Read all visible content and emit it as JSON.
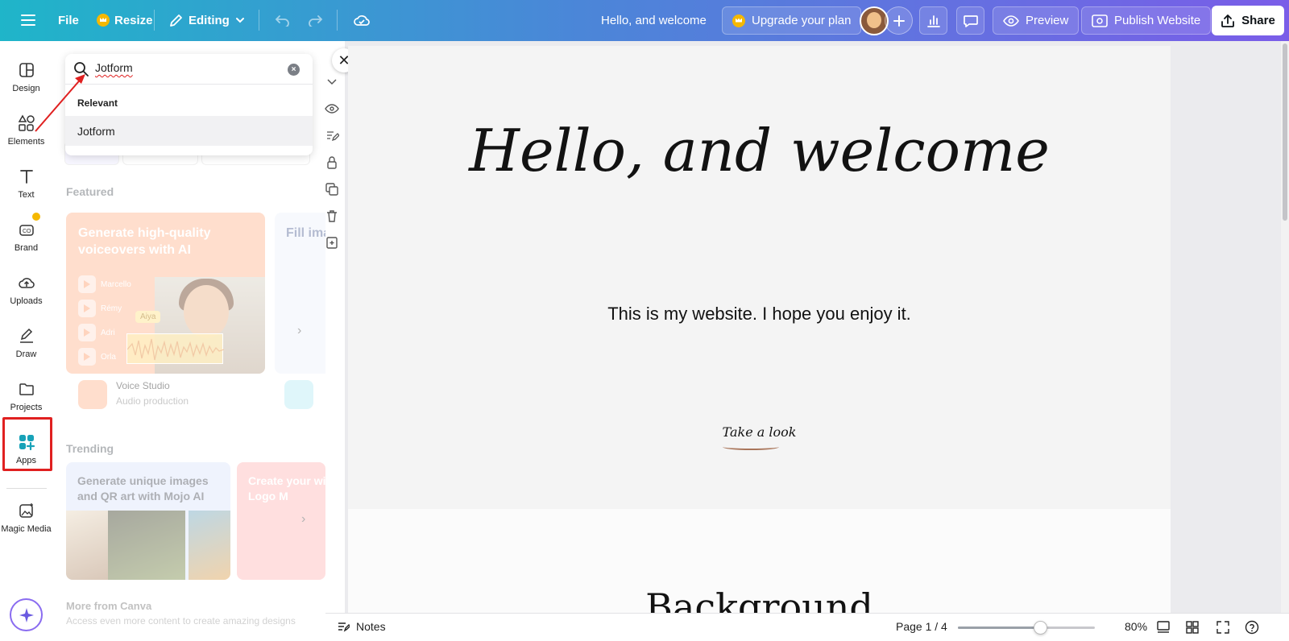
{
  "topbar": {
    "file": "File",
    "resize": "Resize",
    "editing": "Editing",
    "doc_title": "Hello, and welcome",
    "upgrade": "Upgrade your plan",
    "preview": "Preview",
    "publish": "Publish Website",
    "share": "Share"
  },
  "rail": {
    "design": "Design",
    "elements": "Elements",
    "text": "Text",
    "brand": "Brand",
    "uploads": "Uploads",
    "draw": "Draw",
    "projects": "Projects",
    "apps": "Apps",
    "magic_media": "Magic Media"
  },
  "search": {
    "value": "Jotform",
    "relevant_label": "Relevant",
    "result": "Jotform"
  },
  "panel": {
    "featured_title": "Featured",
    "feature1_title": "Generate high-quality voiceovers with AI",
    "feature2_title": "Fill ima",
    "voices": [
      "Marcello",
      "Rémy",
      "Adri",
      "Orla"
    ],
    "wave_label": "Aiya",
    "feature1_app": "Voice Studio",
    "feature1_sub": "Audio production",
    "trending_title": "Trending",
    "trend1_title": "Generate unique images and QR art with Mojo AI",
    "trend2_title": "Create your with Logo M",
    "more_title": "More from Canva",
    "more_sub": "Access even more content to create amazing designs"
  },
  "page": {
    "hero": "Hello, and welcome",
    "subtitle": "This is my website. I hope you enjoy it.",
    "cta": "Take a look",
    "next_section": "Background"
  },
  "bottombar": {
    "notes": "Notes",
    "page_indicator": "Page 1 / 4",
    "zoom": "80%",
    "zoom_fraction": 0.6
  },
  "colors": {
    "accent_purple": "#7a5de8",
    "accent_teal": "#1fb5c9",
    "annotation_red": "#e02020",
    "premium_gold": "#f5b800"
  },
  "icons": [
    "menu-icon",
    "crown-icon",
    "pencil-icon",
    "chevron-down-icon",
    "undo-icon",
    "redo-icon",
    "cloud-sync-icon",
    "plus-icon",
    "analytics-icon",
    "comment-icon",
    "eye-icon",
    "publish-icon",
    "share-icon",
    "search-icon",
    "close-icon",
    "sparkle-icon",
    "notes-icon",
    "grid-icon",
    "fullscreen-icon",
    "help-icon"
  ]
}
